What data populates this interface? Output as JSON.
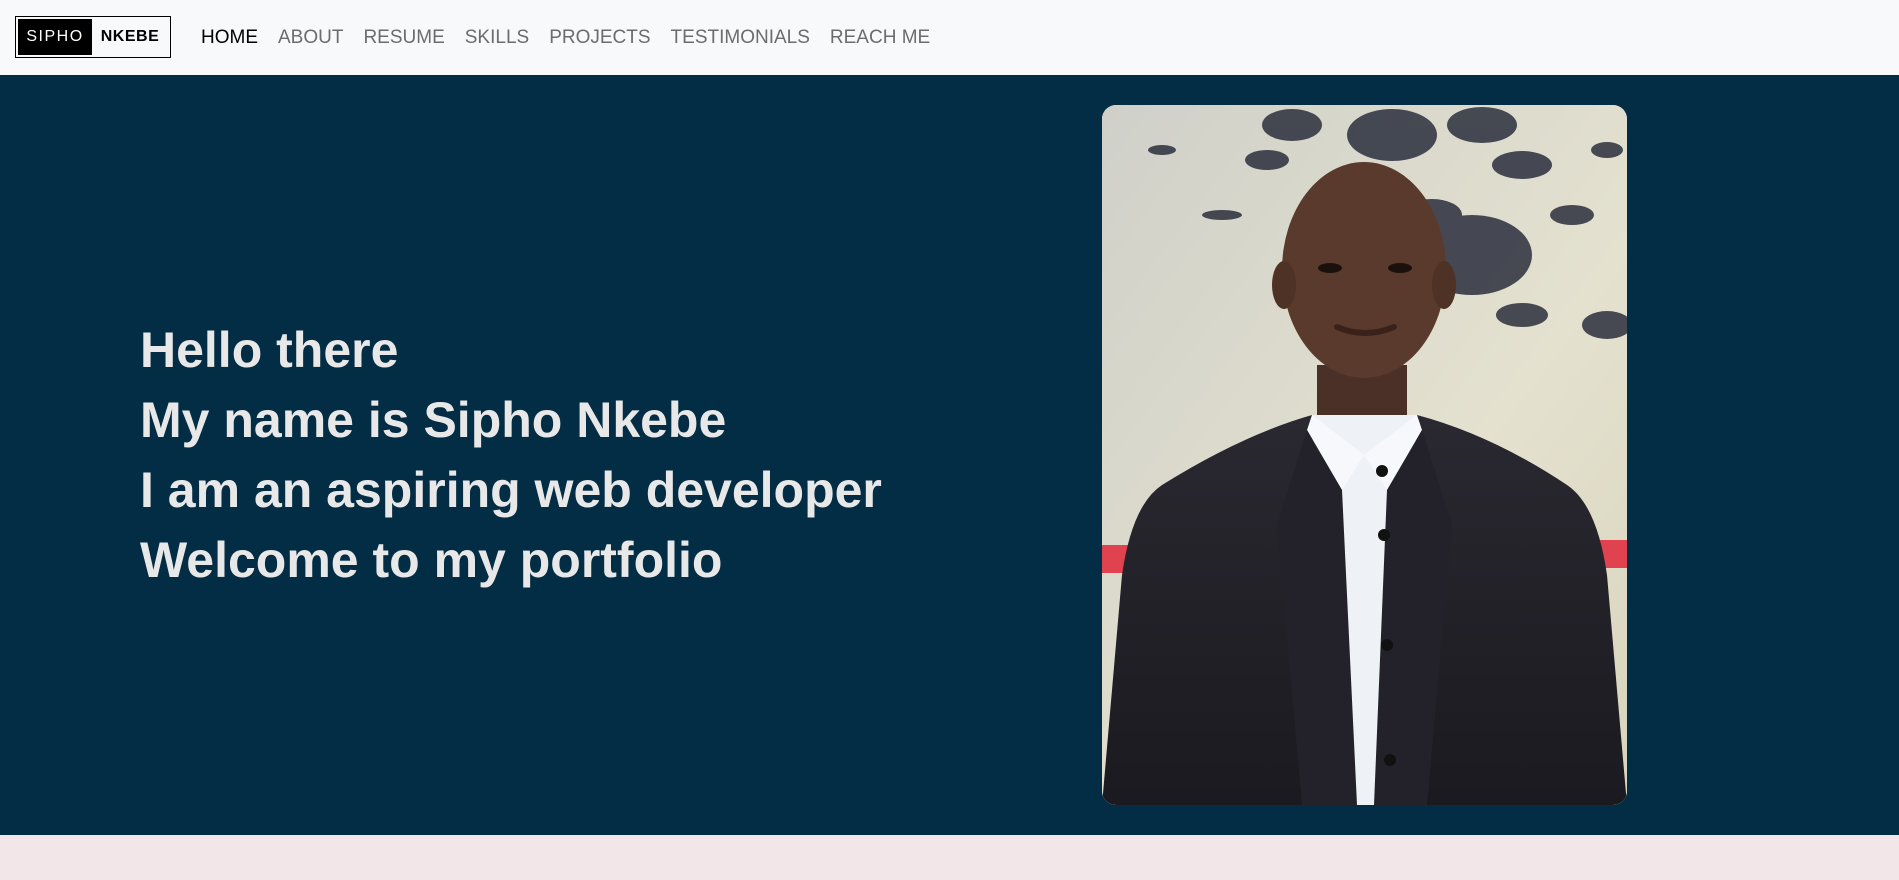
{
  "brand": {
    "first": "SIPHO",
    "last": "NKEBE"
  },
  "nav": {
    "items": [
      {
        "label": "HOME",
        "active": true
      },
      {
        "label": "ABOUT",
        "active": false
      },
      {
        "label": "RESUME",
        "active": false
      },
      {
        "label": "SKILLS",
        "active": false
      },
      {
        "label": "PROJECTS",
        "active": false
      },
      {
        "label": "TESTIMONIALS",
        "active": false
      },
      {
        "label": "REACH ME",
        "active": false
      }
    ]
  },
  "hero": {
    "lines": [
      "Hello there",
      "My name is Sipho Nkebe",
      "I am an aspiring web developer",
      "Welcome to my portfolio"
    ],
    "background_color": "#022d45",
    "text_color": "#e8e8e8"
  },
  "colors": {
    "navbar_bg": "#f8f9fa",
    "next_section_bg": "#f2e6e9"
  }
}
